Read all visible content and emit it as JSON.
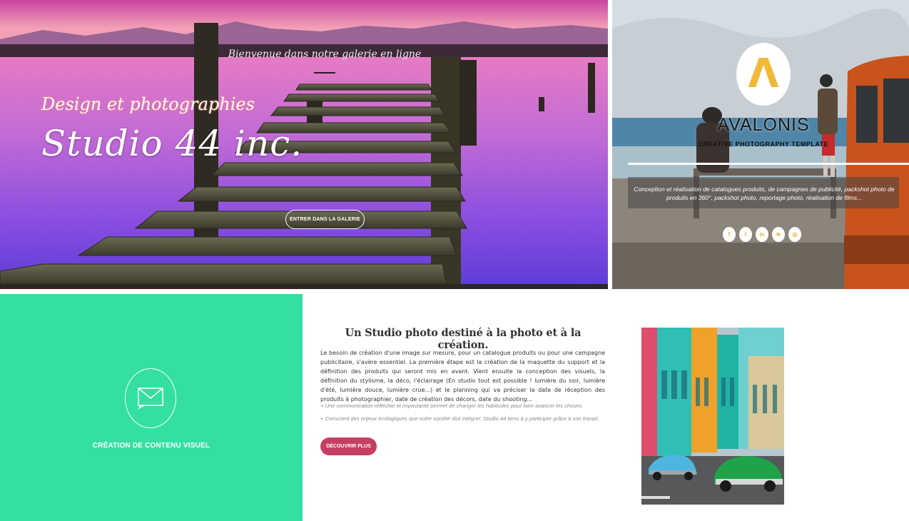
{
  "hero": {
    "welcome": "Bienvenue dans notre galerie en ligne",
    "script_small": "Design et photographies",
    "script_big": "Studio 44 inc.",
    "cta_label": "ENTRER DANS LA GALERIE"
  },
  "promo": {
    "logo_letter": "Λ",
    "title": "AVALONIS",
    "subtitle": "CREATIVE PHOTOGRAPHY TEMPLATE",
    "description": "Conception et réalisation de catalogues produits, de campagnes de publicité, packshot photo de produits en 360°, packshot photo, reportage photo, réalisation de films...",
    "social": [
      {
        "icon": "facebook-icon",
        "glyph": "f"
      },
      {
        "icon": "twitter-icon",
        "glyph": "t"
      },
      {
        "icon": "linkedin-icon",
        "glyph": "in"
      },
      {
        "icon": "rss-icon",
        "glyph": "≋"
      },
      {
        "icon": "dribbble-icon",
        "glyph": "◎"
      }
    ],
    "logo_color": "#f0b93a"
  },
  "feature": {
    "title": "CRÉATION DE CONTENU VISUEL",
    "icon": "envelope-icon",
    "bg_color": "#33e0a1"
  },
  "content": {
    "heading": "Un Studio photo destiné à la photo et à la création.",
    "body": "Le besoin de création d'une image sur mesure, pour un catalogue produits ou pour une campagne publicitaire, s'avère essentiel. La première étape est la création de la maquette du support et la définition des produits qui seront mis en avant. Vient ensuite la conception des visuels, la définition du stylisme, la déco, l'éclairage (En studio tout est possible ! lumière du soir, lumière d'été, lumière douce, lumière crue...) et le planning qui va préciser la date de réception des produits à photographier, date de création des décors, date du shooting...",
    "points": [
      "+ Une communication réfléchie et impactante permet de changer les habitudes pour faire avancer les choses.",
      "+ Conscient des enjeux écologiques que notre société doit intégrer, Studio 44 tiens à y participer grâce à son travail."
    ],
    "cta_label": "DÉCOUVRIR PLUS",
    "cta_color": "#c63f62"
  }
}
